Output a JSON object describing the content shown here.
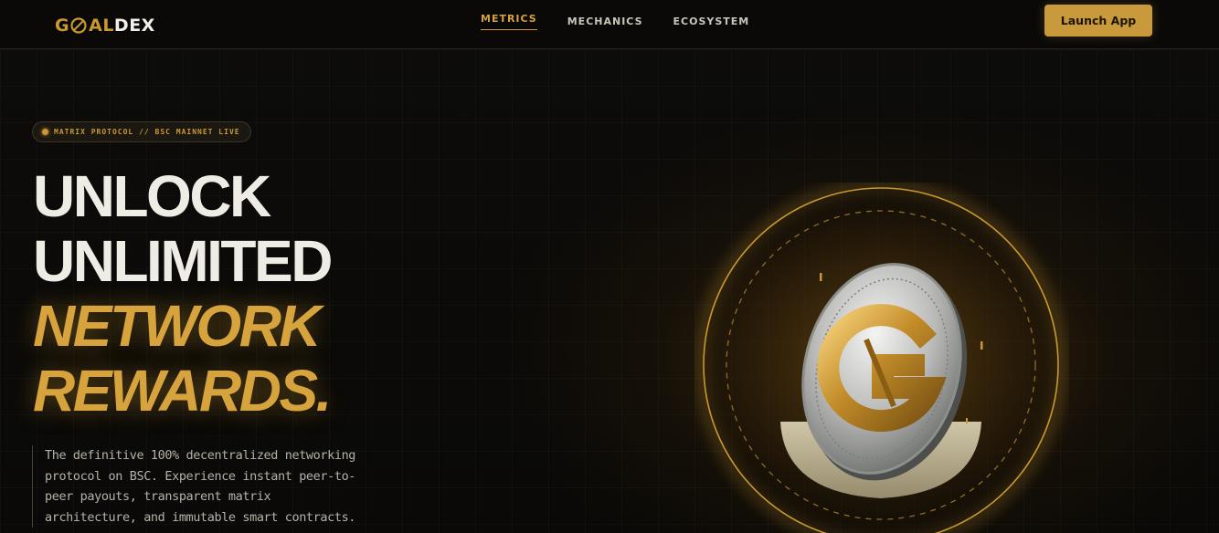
{
  "brand": {
    "part1": "G",
    "part2": "AL",
    "part3": "DEX"
  },
  "nav": {
    "items": [
      {
        "label": "METRICS",
        "active": true
      },
      {
        "label": "MECHANICS",
        "active": false
      },
      {
        "label": "ECOSYSTEM",
        "active": false
      }
    ]
  },
  "header": {
    "cta_label": "Launch App"
  },
  "hero": {
    "badge": "MATRIX PROTOCOL // BSC MAINNET LIVE",
    "headline": {
      "line1": "UNLOCK",
      "line2": "UNLIMITED",
      "line3": "NETWORK",
      "line4": "REWARDS."
    },
    "description": "The definitive 100% decentralized networking protocol on BSC. Experience instant peer-to-peer payouts, transparent matrix architecture, and immutable smart contracts.",
    "coin_icon": "gold-g-coin-icon"
  },
  "colors": {
    "accent": "#c9982f",
    "background": "#0b0a08",
    "text": "#efece6"
  }
}
